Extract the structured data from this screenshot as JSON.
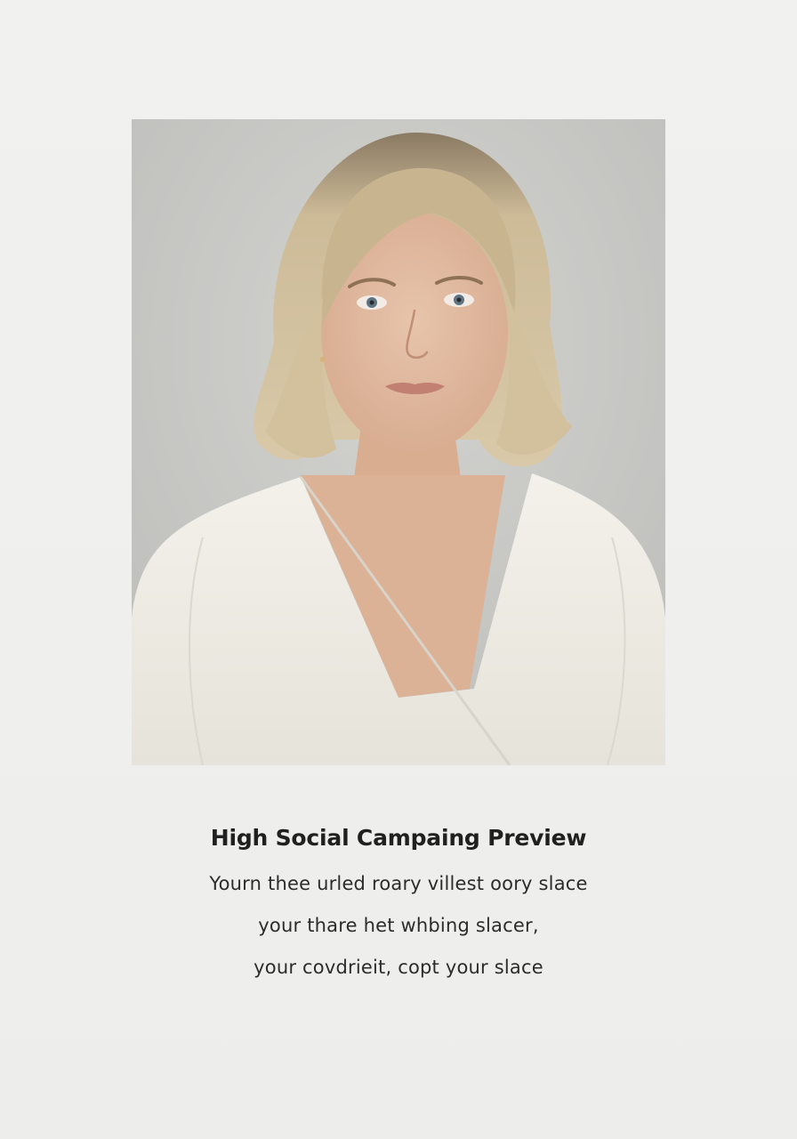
{
  "caption": {
    "title": "High Social Campaing Preview",
    "lines": [
      "Yourn thee urled roary villest oory slace",
      "your thare het whbing slacer,",
      "your covdrieit, copt your slace"
    ]
  },
  "colors": {
    "page_background": "#f0f0ee",
    "photo_background": "#c9c9c6",
    "title_text": "#202020",
    "body_text": "#2c2c2c"
  }
}
